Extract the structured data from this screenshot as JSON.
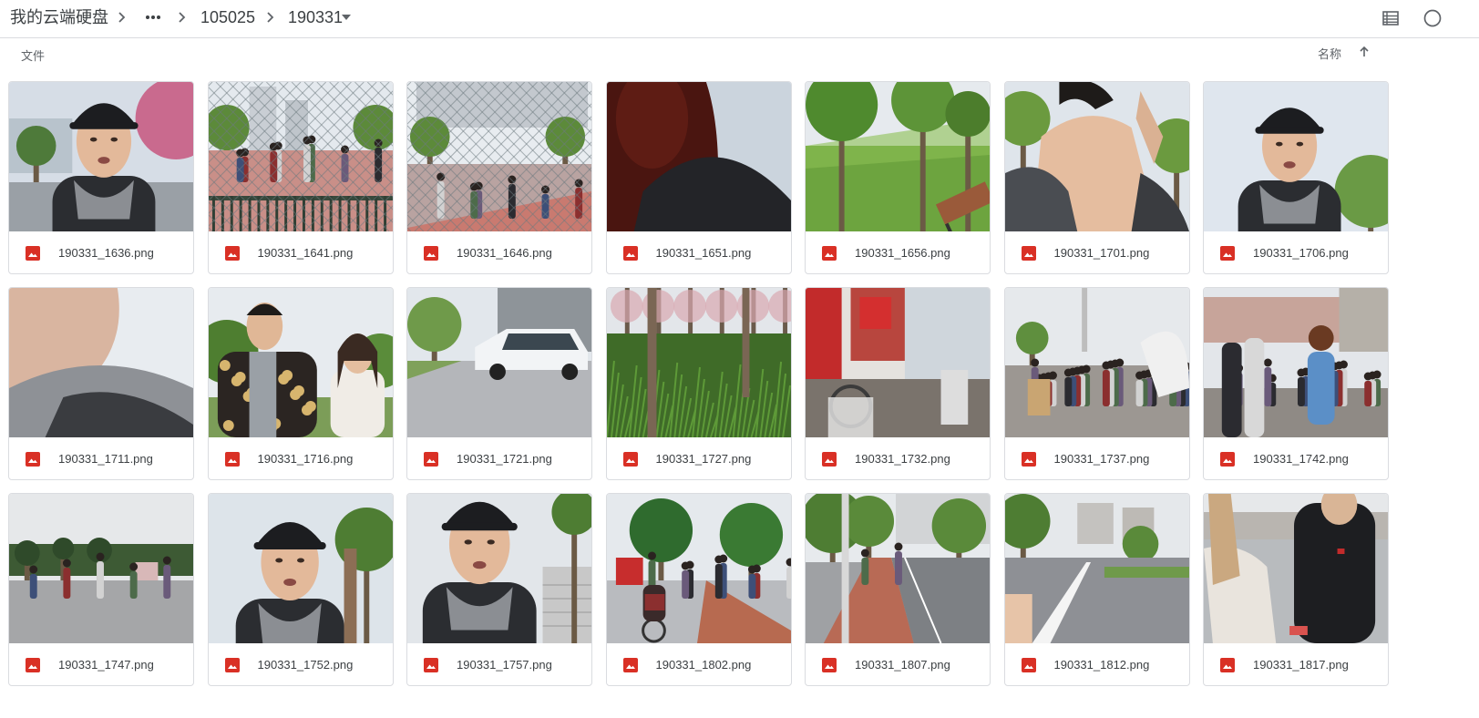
{
  "breadcrumb": {
    "root": "我的云端硬盘",
    "parent": "105025",
    "current": "190331"
  },
  "section_label": "文件",
  "sort": {
    "label": "名称",
    "direction": "ascending"
  },
  "icons": {
    "file_type": "image-file-icon",
    "file_type_color": "#d93025",
    "more": "more-horizontal-icon",
    "separator": "chevron-right-icon",
    "dropdown": "dropdown-arrow-icon",
    "list_view": "list-view-icon",
    "info": "info-icon",
    "sort": "arrow-up-icon"
  },
  "files": [
    {
      "name": "190331_1636.png",
      "scene": "selfie-cap-trees"
    },
    {
      "name": "190331_1641.png",
      "scene": "fence-court"
    },
    {
      "name": "190331_1646.png",
      "scene": "fence-court-players"
    },
    {
      "name": "190331_1651.png",
      "scene": "dark-closeup"
    },
    {
      "name": "190331_1656.png",
      "scene": "park-grass-bench"
    },
    {
      "name": "190331_1701.png",
      "scene": "selfie-neck-hand"
    },
    {
      "name": "190331_1706.png",
      "scene": "selfie-cap-sky"
    },
    {
      "name": "190331_1711.png",
      "scene": "chin-closeup"
    },
    {
      "name": "190331_1716.png",
      "scene": "two-people"
    },
    {
      "name": "190331_1721.png",
      "scene": "white-car"
    },
    {
      "name": "190331_1727.png",
      "scene": "grass-trees"
    },
    {
      "name": "190331_1732.png",
      "scene": "shop-street"
    },
    {
      "name": "190331_1737.png",
      "scene": "crowd-street"
    },
    {
      "name": "190331_1742.png",
      "scene": "crowd-walking"
    },
    {
      "name": "190331_1747.png",
      "scene": "plaza"
    },
    {
      "name": "190331_1752.png",
      "scene": "selfie-cap-tree"
    },
    {
      "name": "190331_1757.png",
      "scene": "selfie-stairs"
    },
    {
      "name": "190331_1802.png",
      "scene": "sidewalk-cyclist"
    },
    {
      "name": "190331_1807.png",
      "scene": "treelined-road"
    },
    {
      "name": "190331_1812.png",
      "scene": "city-road"
    },
    {
      "name": "190331_1817.png",
      "scene": "two-walking"
    }
  ]
}
